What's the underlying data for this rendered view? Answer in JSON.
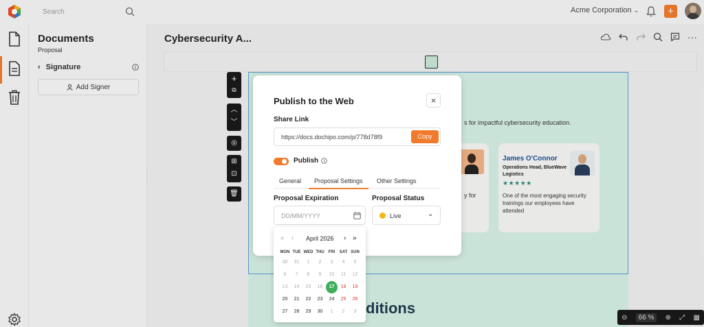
{
  "topbar": {
    "search_placeholder": "Search",
    "org_name": "Acme Corporation"
  },
  "panel": {
    "title": "Documents",
    "subtitle": "Proposal",
    "section": "Signature",
    "add_signer": "Add Signer"
  },
  "doc": {
    "title": "Cybersecurity A...",
    "intro_fragment": "s for impactful cybersecurity education.",
    "card2_fragment": "y for",
    "heading_fragment": "ditions"
  },
  "testimonial": {
    "name": "James O'Connor",
    "role": "Operations Head, BlueWave Logistics",
    "stars": "★★★★★",
    "quote": "One of the most engaging security trainings our employees have attended"
  },
  "modal": {
    "title": "Publish to the Web",
    "share_label": "Share Link",
    "share_url": "https://docs.dochipo.com/p/778d78f9",
    "copy_label": "Copy",
    "publish_label": "Publish",
    "tabs": [
      "General",
      "Proposal Settings",
      "Other Settings"
    ],
    "active_tab": 1,
    "expiration_label": "Proposal Expiration",
    "expiration_placeholder": "DD/MM/YYYY",
    "status_label": "Proposal Status",
    "status_value": "Live"
  },
  "calendar": {
    "month_label": "April 2026",
    "weekdays": [
      "MON",
      "TUE",
      "WED",
      "THU",
      "FRI",
      "SAT",
      "SUN"
    ],
    "weeks": [
      [
        "30",
        "31",
        "1",
        "2",
        "3",
        "4",
        "5"
      ],
      [
        "6",
        "7",
        "8",
        "9",
        "10",
        "11",
        "12"
      ],
      [
        "13",
        "14",
        "15",
        "16",
        "17",
        "18",
        "19"
      ],
      [
        "20",
        "21",
        "22",
        "23",
        "24",
        "25",
        "26"
      ],
      [
        "27",
        "28",
        "29",
        "30",
        "1",
        "2",
        "3"
      ]
    ],
    "today": "17"
  },
  "zoom": {
    "value": "66",
    "unit": "%"
  },
  "colors": {
    "accent": "#f07b2c",
    "green": "#3fae5a",
    "sat_sun": "#d9352d",
    "doc_bg": "#d5f0e4"
  }
}
